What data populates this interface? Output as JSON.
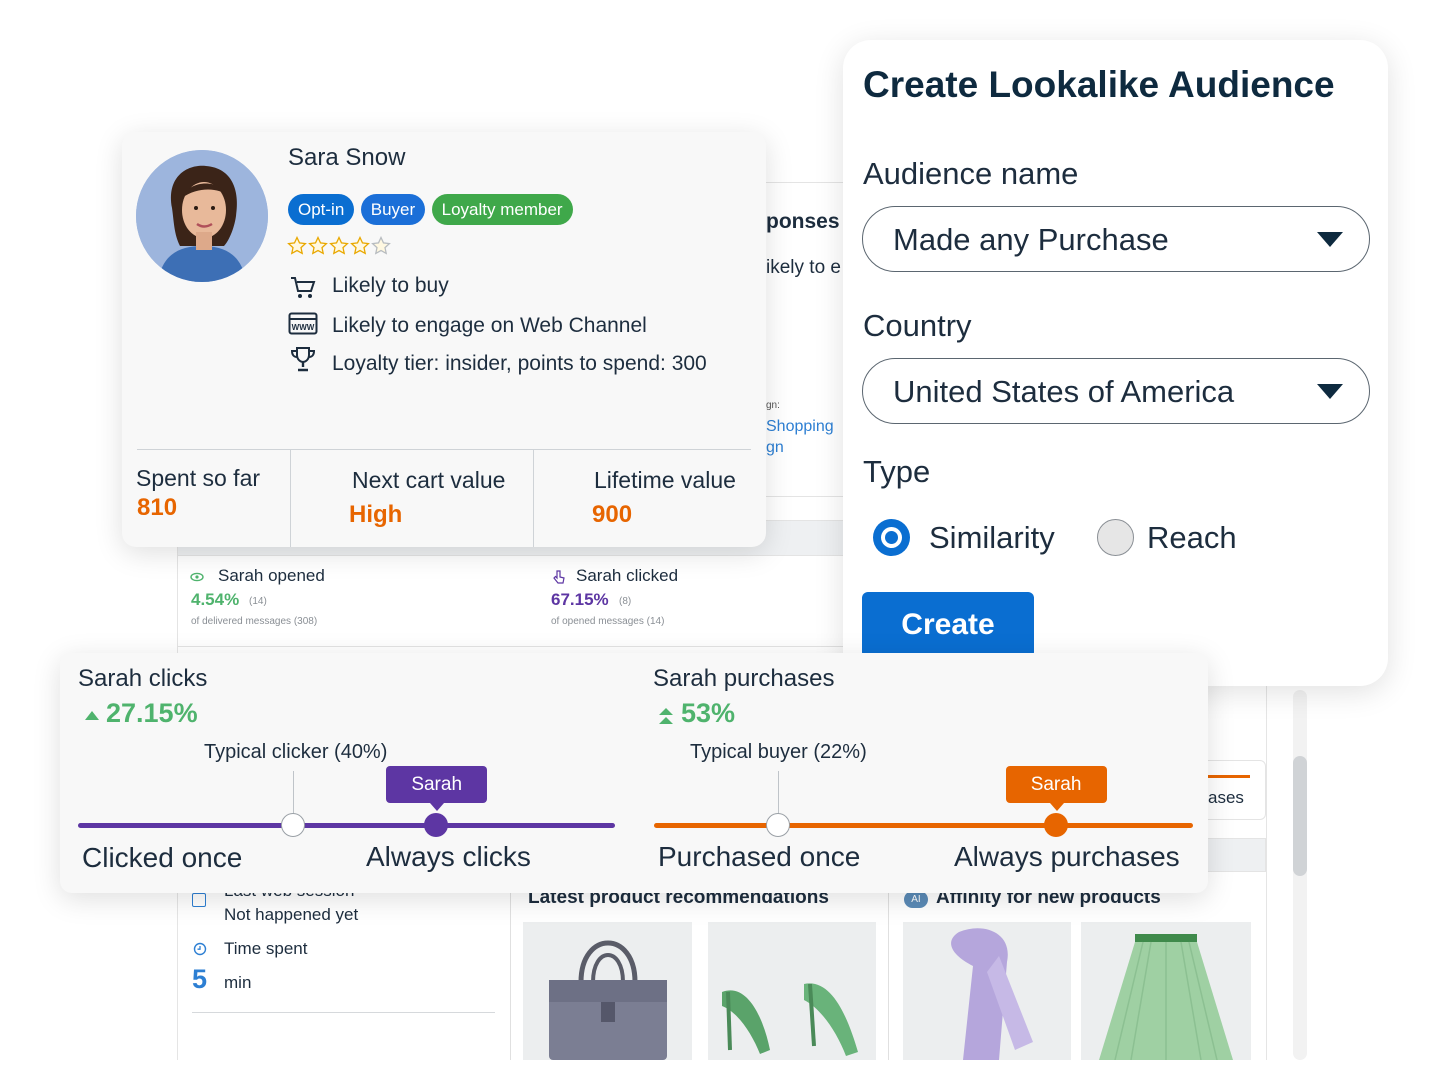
{
  "colors": {
    "accent_blue": "#0a6ed1",
    "purple": "#5d36a3",
    "orange": "#e76500",
    "green": "#4fb36d",
    "pill_optin": "#0a6ed1",
    "pill_buyer": "#1b6fd8",
    "pill_loyalty": "#3fa84a"
  },
  "background": {
    "partial_title": "ponses",
    "partial_text": "ikely to e",
    "campaign_small": "gn:",
    "campaign_link_1": "Shopping",
    "campaign_link_2": "gn",
    "opened": {
      "label": "Sarah opened",
      "value": "4.54%",
      "count": "(14)",
      "sub": "of delivered messages (308)"
    },
    "clicked": {
      "label": "Sarah clicked",
      "value": "67.15%",
      "count": "(8)",
      "sub": "of opened messages (14)"
    },
    "partial_purchases": "ases",
    "web_session": {
      "label": "Last web session",
      "value": "Not happened yet"
    },
    "time_spent": {
      "label": "Time spent",
      "value": "5",
      "unit": "min"
    },
    "recommendations_title": "Latest product recommendations",
    "affinity_badge": "AI",
    "affinity_title": "Affinity for new products"
  },
  "profile": {
    "name": "Sara Snow",
    "badges": [
      "Opt-in",
      "Buyer",
      "Loyalty member"
    ],
    "rating": 4,
    "rating_max": 5,
    "rows": [
      {
        "icon": "cart-icon",
        "text": "Likely to buy"
      },
      {
        "icon": "www-icon",
        "text": "Likely to engage on Web Channel"
      },
      {
        "icon": "trophy-icon",
        "text": "Loyalty tier: insider, points to spend: 300"
      }
    ],
    "stats": [
      {
        "label": "Spent so far",
        "value": "810"
      },
      {
        "label": "Next cart value",
        "value": "High"
      },
      {
        "label": "Lifetime value",
        "value": "900"
      }
    ]
  },
  "dialog": {
    "title": "Create Lookalike Audience",
    "audience_label": "Audience name",
    "audience_value": "Made any Purchase",
    "country_label": "Country",
    "country_value": "United States of America",
    "type_label": "Type",
    "type_options": [
      "Similarity",
      "Reach"
    ],
    "type_selected": "Similarity",
    "create_button": "Create"
  },
  "compare": {
    "clicks": {
      "title": "Sarah clicks",
      "pct": "27.15%",
      "typical": "Typical clicker (40%)",
      "tag": "Sarah",
      "left_label": "Clicked once",
      "right_label": "Always clicks",
      "typical_level": 0.4,
      "sarah_level": 0.667
    },
    "purchases": {
      "title": "Sarah purchases",
      "pct": "53%",
      "typical": "Typical buyer (22%)",
      "tag": "Sarah",
      "left_label": "Purchased once",
      "right_label": "Always purchases",
      "typical_level": 0.23,
      "sarah_level": 0.745
    }
  }
}
